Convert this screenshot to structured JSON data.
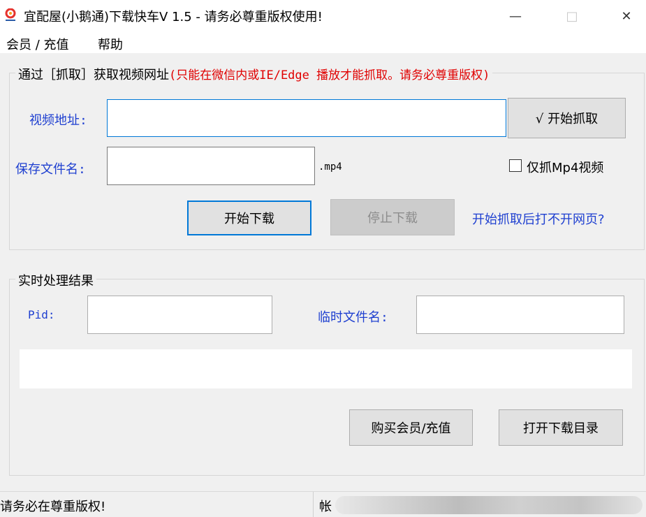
{
  "window": {
    "title": "宜配屋(小鹅通)下载快车V 1.5 - 请务必尊重版权使用!",
    "min_glyph": "—",
    "max_glyph": "□",
    "close_glyph": "✕"
  },
  "menu": {
    "items": [
      "会员 / 充值",
      "帮助"
    ]
  },
  "capture_group": {
    "legend_prefix": "通过［抓取］获取视频网址",
    "legend_note": "(只能在微信内或IE/Edge 播放才能抓取。请务必尊重版权)",
    "video_url_label": "视频地址:",
    "video_url_value": "",
    "start_capture_label": "√ 开始抓取",
    "save_filename_label": "保存文件名:",
    "save_filename_value": "",
    "extension_label": ".mp4",
    "mp4_only_label": "仅抓Mp4视频",
    "mp4_only_checked": false,
    "start_download_label": "开始下载",
    "stop_download_label": "停止下载",
    "help_link_label": "开始抓取后打不开网页?"
  },
  "result_group": {
    "legend": "实时处理结果",
    "pid_label": "Pid:",
    "pid_value": "",
    "temp_filename_label": "临时文件名:",
    "temp_filename_value": "",
    "log_text": "",
    "buy_member_label": "购买会员/充值",
    "open_dir_label": "打开下载目录"
  },
  "status": {
    "left_text": "请务必在尊重版权!",
    "account_prefix": "帐"
  },
  "colors": {
    "accent_blue": "#1e3fd0",
    "warning_red": "#e00000",
    "focus_border": "#0078d7"
  }
}
